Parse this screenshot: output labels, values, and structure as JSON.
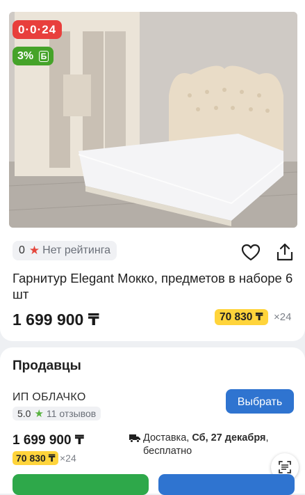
{
  "product": {
    "promo_badge": "0·0·24",
    "bonus_badge": "3%",
    "bonus_currency": "Б",
    "review_count": "0",
    "rating_text": "Нет рейтинга",
    "title": "Гарнитур Elegant Мокко, предметов в наборе 6 шт",
    "price": "1 699 900 ₸",
    "installment_price": "70 830 ₸",
    "installment_months": "×24"
  },
  "icons": {
    "favorite": "heart-icon",
    "share": "share-icon",
    "rating_star": "star-icon",
    "delivery": "truck-icon",
    "scanner": "scan-icon"
  },
  "sellers": {
    "section_title": "Продавцы",
    "items": [
      {
        "name": "ИП ОБЛАЧКО",
        "rating": "5.0",
        "reviews": "11 отзывов",
        "choose_label": "Выбрать",
        "price": "1 699 900 ₸",
        "installment_price": "70 830 ₸",
        "installment_months": "×24",
        "delivery_prefix": "Доставка, ",
        "delivery_date": "Сб, 27 декабря",
        "delivery_suffix": ", бесплатно"
      }
    ]
  },
  "colors": {
    "promo_red": "#e83f3c",
    "bonus_green": "#45a329",
    "installment_yellow": "#ffd43b",
    "primary_blue": "#2f74d0",
    "action_green": "#2ea84a"
  }
}
